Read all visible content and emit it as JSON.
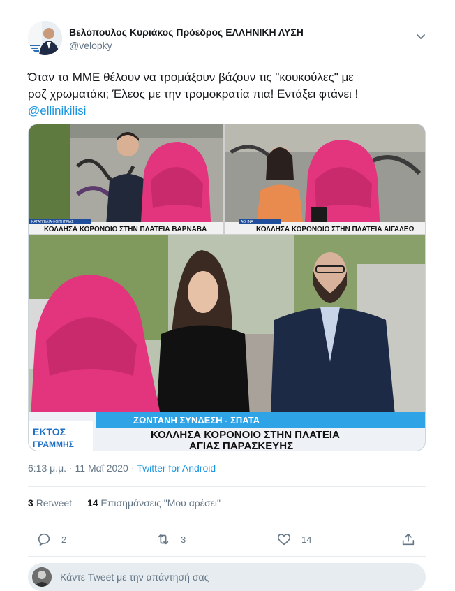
{
  "author": {
    "name": "Βελόπουλος Κυριάκος Πρόεδρος ΕΛΛΗΝΙΚΗ ΛΥΣΗ",
    "handle": "@velopky",
    "avatar_icon": "profile-photo"
  },
  "tweet": {
    "text_line1": "Όταν τα ΜΜΕ θέλουν να τρομάξουν βάζουν τις \"κουκούλες\" με",
    "text_line2": "ροζ χρωματάκι; Έλεος με την τρομοκρατία πια! Εντάξει φτάνει !",
    "mention": "@ellinikilisi"
  },
  "media": {
    "panel_top_left_caption": "ΚΟΛΛΗΣΑ ΚΟΡΟΝΟΙΟ ΣΤΗΝ ΠΛΑΤΕΙΑ ΒΑΡΝΑΒΑ",
    "panel_top_left_label": "ΚΑΤΑΓΓΕΛΙΑ ΦΟΙΤΗΤΡΙΑΣ",
    "panel_top_right_caption": "ΚΟΛΛΗΣΑ ΚΟΡΟΝΟΙΟ ΣΤΗΝ ΠΛΑΤΕΙΑ ΑΙΓΑΛΕΩ",
    "panel_top_right_label": "ΑΘΗΝΑ",
    "bottom_live_label": "ΖΩΝΤΑΝΗ ΣΥΝΔΕΣΗ - ΣΠΑΤΑ",
    "bottom_caption_line1": "ΚΟΛΛΗΣΑ ΚΟΡΟΝΟΙΟ ΣΤΗΝ ΠΛΑΤΕΙΑ",
    "bottom_caption_line2": "ΑΓΙΑΣ ΠΑΡΑΣΚΕΥΗΣ",
    "logo_line1": "ΕΚΤΟΣ",
    "logo_line2": "ΓΡΑΜΜΗΣ",
    "hood_color": "#e2357e"
  },
  "meta": {
    "time": "6:13 μ.μ.",
    "separator": " · ",
    "date": "11 Μαΐ 2020",
    "source": "Twitter for Android"
  },
  "stats": {
    "retweets_count": "3",
    "retweets_label": "Retweet",
    "likes_count": "14",
    "likes_label": "Επισημάνσεις \"Μου αρέσει\""
  },
  "actions": {
    "reply_count": "2",
    "retweet_count": "3",
    "like_count": "14"
  },
  "reply": {
    "placeholder": "Κάντε Tweet με την απάντησή σας"
  },
  "colors": {
    "accent": "#1b95e0",
    "secondary_text": "#657786",
    "divider": "#e6ecf0"
  }
}
